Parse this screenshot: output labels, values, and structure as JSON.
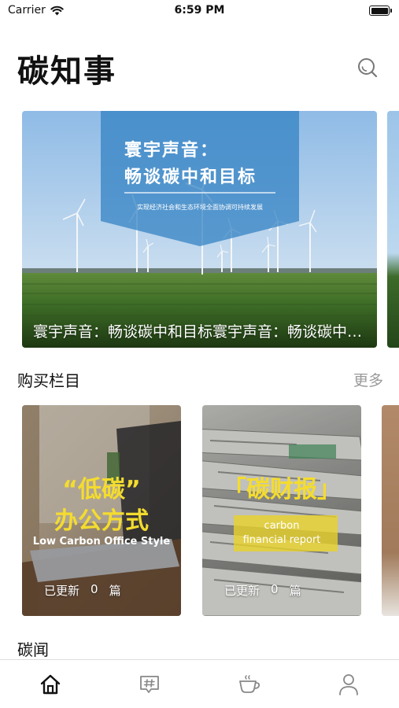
{
  "status_bar": {
    "carrier": "Carrier",
    "time": "6:59 PM",
    "icons": [
      "wifi-icon",
      "battery-icon"
    ]
  },
  "header": {
    "title": "碳知事",
    "search_icon": "search-icon"
  },
  "banner": {
    "overlay_title_line1": "寰宇声音：",
    "overlay_title_line2": "畅谈碳中和目标",
    "overlay_subtitle": "实现经济社会和生态环境全面协调可持续发展",
    "caption": "寰宇声音：畅谈碳中和目标寰宇声音：畅谈碳中和目标"
  },
  "purchase_section": {
    "title": "购买栏目",
    "more_label": "更多",
    "cards": [
      {
        "title_line1": "“低碳”",
        "title_line2": "办公方式",
        "subtitle": "Low Carbon Office Style",
        "updated_label": "已更新",
        "count": "0",
        "unit": "篇"
      },
      {
        "title": "「碳财报」",
        "subtitle_line1": "carbon",
        "subtitle_line2": "financial report",
        "updated_label": "已更新",
        "count": "0",
        "unit": "篇"
      }
    ]
  },
  "news_section": {
    "title": "碳闻"
  },
  "tab_bar": {
    "tabs": [
      "home-icon",
      "topic-hashtag-icon",
      "coffee-cup-icon",
      "profile-icon"
    ],
    "active": "home-icon",
    "active_color": "#111111",
    "inactive_color": "#888888"
  }
}
